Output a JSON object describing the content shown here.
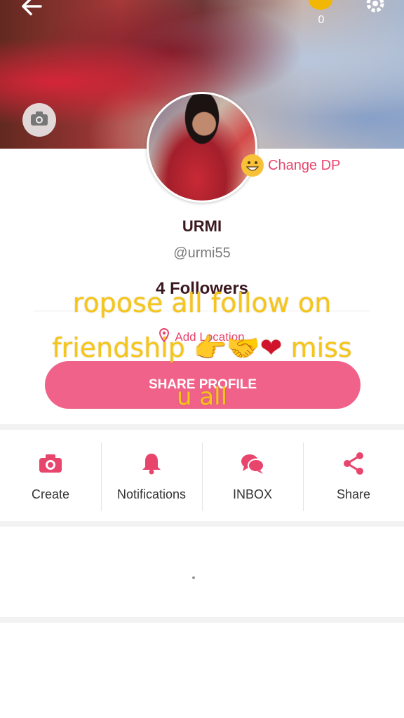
{
  "header": {
    "coin_count": "0"
  },
  "profile": {
    "change_dp_label": "Change DP",
    "name": "URMI",
    "handle": "@urmi55",
    "followers": "4 Followers",
    "add_location": "Add Location",
    "share_button": "SHARE PROFILE"
  },
  "overlay": {
    "line1": "ropose all follow on",
    "line2_text": "friendship",
    "line2_emojis": "👉🤝",
    "line2_heart": "❤",
    "line2_end": "miss",
    "line3": "u all"
  },
  "actions": [
    {
      "label": "Create",
      "icon": "camera-icon"
    },
    {
      "label": "Notifications",
      "icon": "bell-icon"
    },
    {
      "label": "INBOX",
      "icon": "chat-bubbles-icon"
    },
    {
      "label": "Share",
      "icon": "share-icon"
    }
  ],
  "colors": {
    "accent": "#e8456d",
    "button": "#f06289",
    "overlay_text": "#f5c518"
  }
}
